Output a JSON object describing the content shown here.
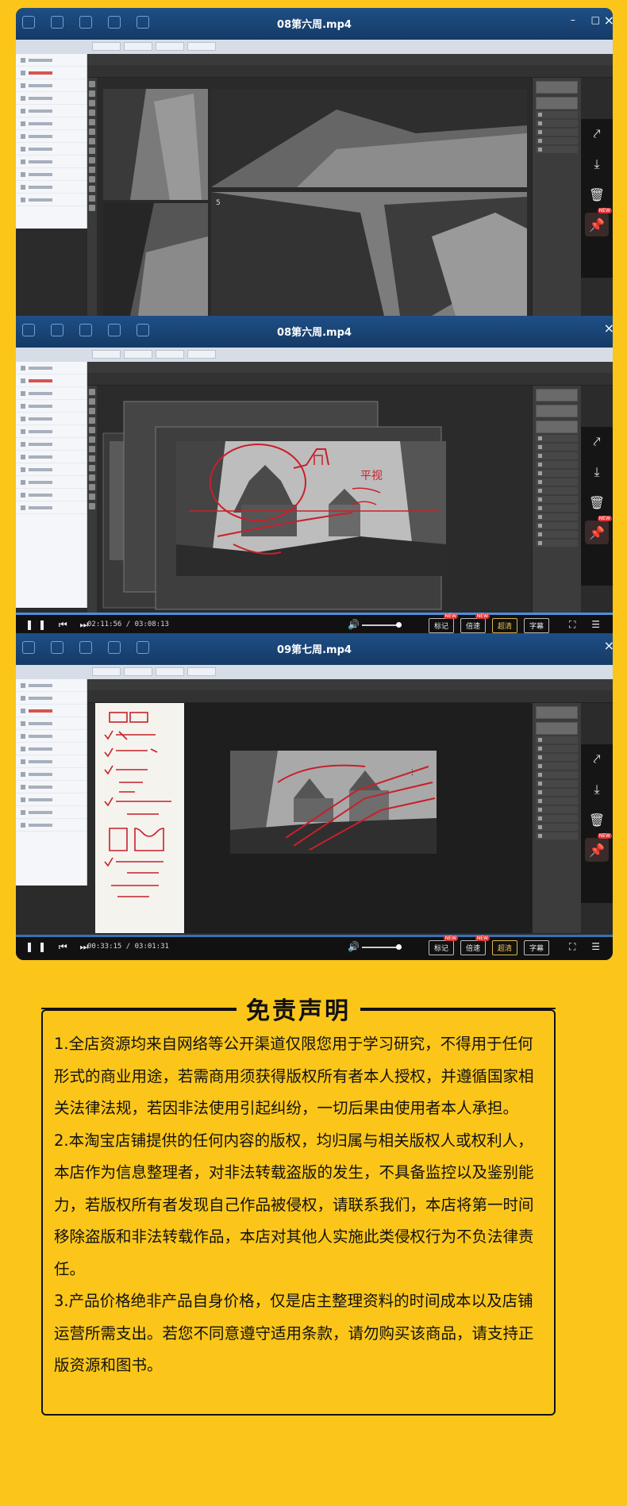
{
  "screenshots": [
    {
      "title": "08第六周.mp4"
    },
    {
      "title": "08第六周.mp4",
      "timecode": "02:11:56 / 03:08:13",
      "annotation_handwriting": "平视",
      "controls": [
        "标记",
        "倍速",
        "超清",
        "字幕"
      ],
      "badges": [
        "NEW",
        "NEW"
      ]
    },
    {
      "title": "09第七周.mp4",
      "timecode": "00:33:15 / 03:01:31",
      "controls": [
        "标记",
        "倍速",
        "超清",
        "字幕"
      ],
      "badges": [
        "NEW",
        "NEW"
      ]
    }
  ],
  "side_actions": [
    {
      "icon": "share-icon"
    },
    {
      "icon": "download-icon"
    },
    {
      "icon": "trash-icon"
    },
    {
      "icon": "pin-icon",
      "badge": "NEW"
    }
  ],
  "disclaimer": {
    "title": "免责声明",
    "paragraphs": [
      "1.全店资源均来自网络等公开渠道仅限您用于学习研究，不得用于任何形式的商业用途，若需商用须获得版权所有者本人授权，并遵循国家相关法律法规，若因非法使用引起纠纷，一切后果由使用者本人承担。",
      "2.本淘宝店铺提供的任何内容的版权，均归属与相关版权人或权利人，本店作为信息整理者，对非法转载盗版的发生，不具备监控以及鉴别能力，若版权所有者发现自己作品被侵权，请联系我们，本店将第一时间移除盗版和非法转载作品，本店对其他人实施此类侵权行为不负法律责任。",
      "3.产品价格绝非产品自身价格，仅是店主整理资料的时间成本以及店铺运营所需支出。若您不同意遵守适用条款，请勿购买该商品，请支持正版资源和图书。"
    ]
  },
  "colors": {
    "page_background": "#fbc619",
    "titlebar": "#1e4f86",
    "annotation_red": "#c8202a",
    "accent_blue": "#4d8fe0"
  }
}
